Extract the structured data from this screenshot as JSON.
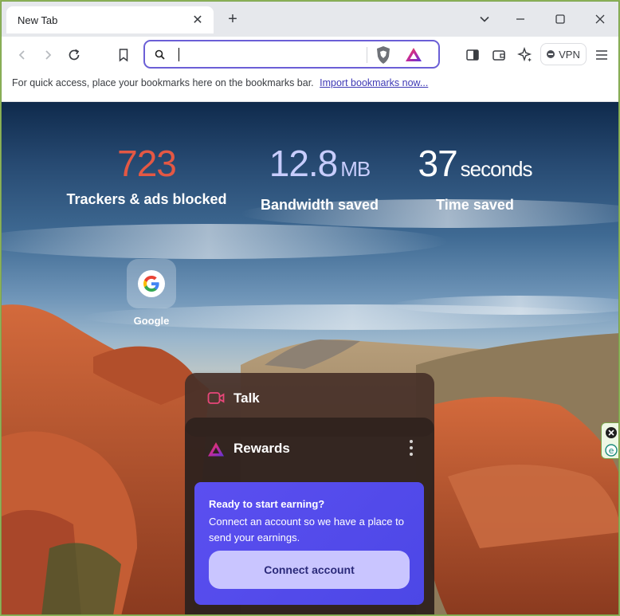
{
  "tab": {
    "title": "New Tab",
    "close_glyph": "✕"
  },
  "window_controls": {
    "dropdown": "⌄",
    "minimize": "—",
    "maximize": "☐",
    "close": "✕"
  },
  "toolbar": {
    "vpn_label": "VPN"
  },
  "bookmarks_bar": {
    "hint": "For quick access, place your bookmarks here on the bookmarks bar.",
    "import_link": "Import bookmarks now..."
  },
  "stats": [
    {
      "value": "723",
      "unit": "",
      "label": "Trackers & ads blocked",
      "color": "#e45844"
    },
    {
      "value": "12.8",
      "unit": "MB",
      "label": "Bandwidth saved",
      "color": "#c8cdfd"
    },
    {
      "value": "37",
      "unit": "seconds",
      "label": "Time saved",
      "color": "#ffffff"
    }
  ],
  "top_sites": [
    {
      "label": "Google",
      "icon": "google-icon"
    }
  ],
  "widgets": {
    "talk": {
      "title": "Talk"
    },
    "rewards": {
      "title": "Rewards",
      "heading": "Ready to start earning?",
      "body": "Connect an account so we have a place to send your earnings.",
      "button": "Connect account"
    }
  },
  "colors": {
    "accent": "#6b5fd6",
    "rewards_panel": "#4c47e6",
    "talk_icon": "#e8477a"
  }
}
